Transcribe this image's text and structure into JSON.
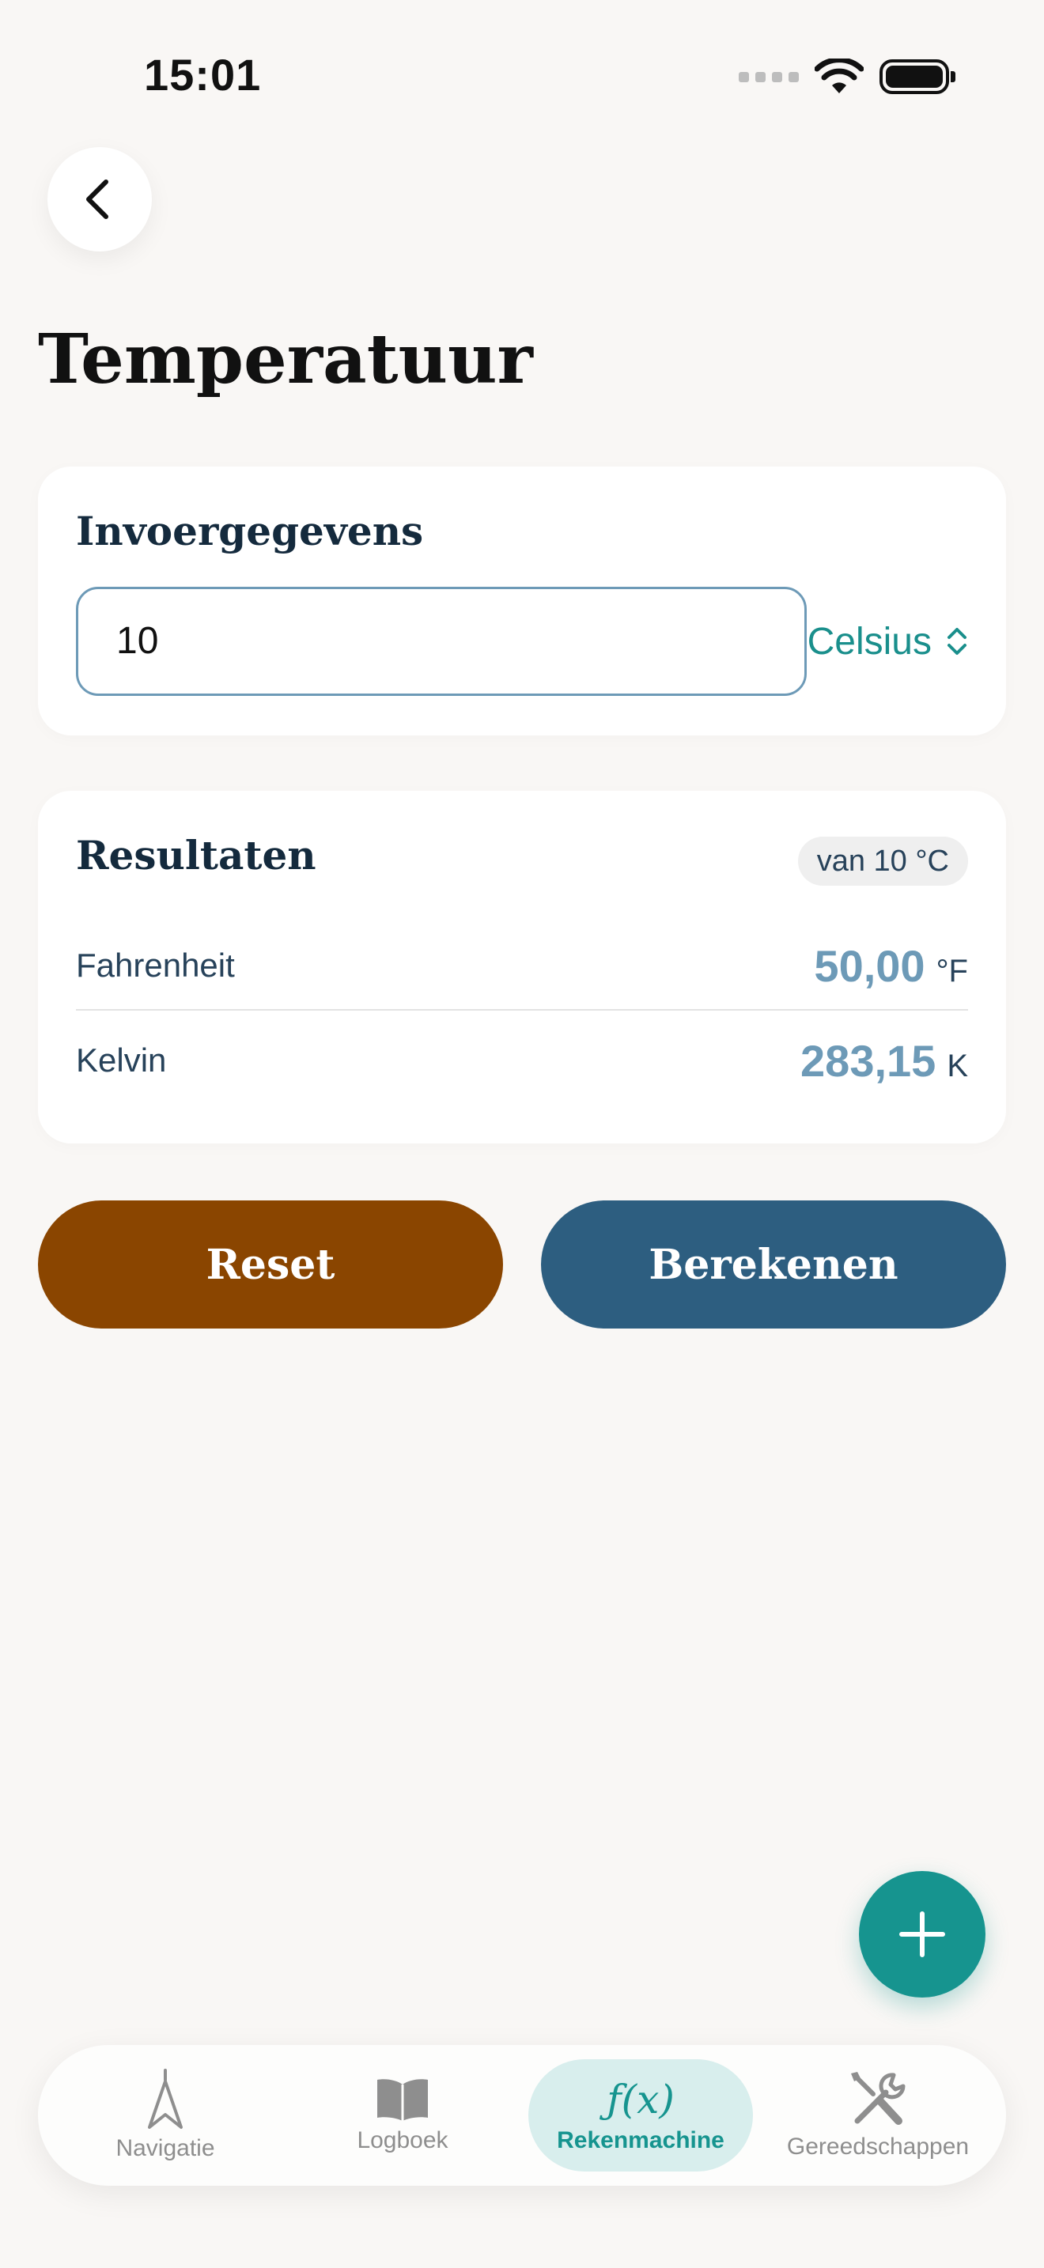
{
  "status_bar": {
    "time": "15:01"
  },
  "header": {
    "title": "Temperatuur"
  },
  "input_card": {
    "title": "Invoergegevens",
    "value": "10",
    "unit": "Celsius"
  },
  "results": {
    "title": "Resultaten",
    "badge": "van 10 °C",
    "rows": [
      {
        "label": "Fahrenheit",
        "value": "50,00",
        "unit": "°F"
      },
      {
        "label": "Kelvin",
        "value": "283,15",
        "unit": "K"
      }
    ]
  },
  "actions": {
    "reset": "Reset",
    "calculate": "Berekenen"
  },
  "tabs": [
    {
      "label": "Navigatie",
      "icon": "navigation-icon",
      "active": false
    },
    {
      "label": "Logboek",
      "icon": "book-icon",
      "active": false
    },
    {
      "label": "Rekenmachine",
      "icon": "function-icon",
      "active": true,
      "glyph": "ƒ(x)"
    },
    {
      "label": "Gereedschappen",
      "icon": "tools-icon",
      "active": false
    }
  ],
  "colors": {
    "accent": "#16948f",
    "primary": "#2d5e80",
    "reset": "#8a4500",
    "result_value": "#6d9ab7"
  }
}
